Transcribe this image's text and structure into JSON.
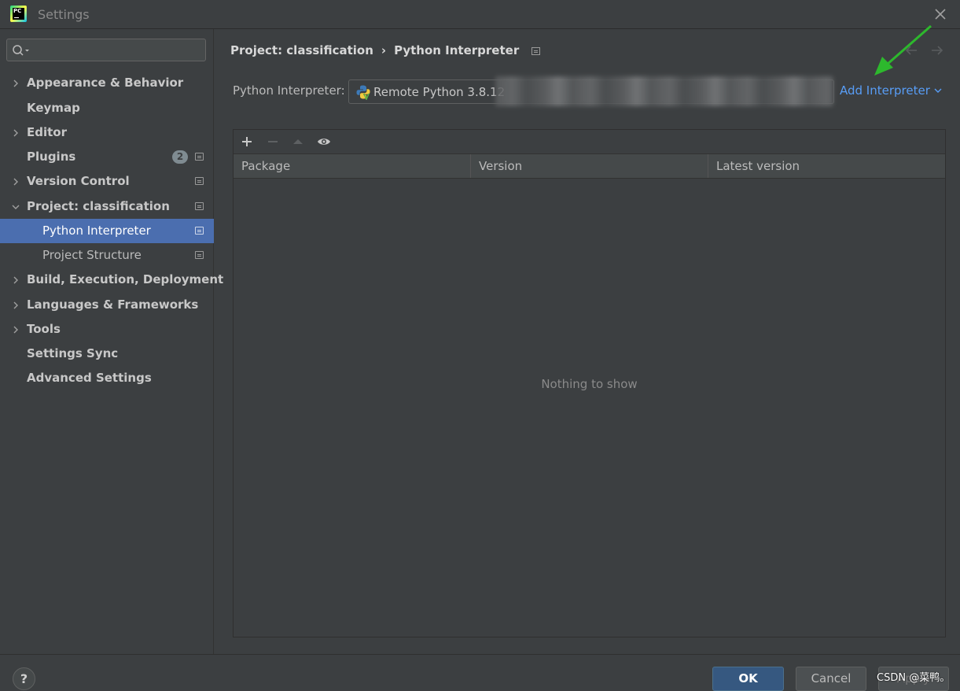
{
  "window": {
    "title": "Settings"
  },
  "sidebar": {
    "search_placeholder": "",
    "items": [
      {
        "label": "Appearance & Behavior"
      },
      {
        "label": "Keymap"
      },
      {
        "label": "Editor"
      },
      {
        "label": "Plugins",
        "badge": "2"
      },
      {
        "label": "Version Control"
      },
      {
        "label": "Project: classification"
      },
      {
        "label": "Python Interpreter"
      },
      {
        "label": "Project Structure"
      },
      {
        "label": "Build, Execution, Deployment"
      },
      {
        "label": "Languages & Frameworks"
      },
      {
        "label": "Tools"
      },
      {
        "label": "Settings Sync"
      },
      {
        "label": "Advanced Settings"
      }
    ],
    "selected": "Python Interpreter"
  },
  "breadcrumb": {
    "parent": "Project: classification",
    "current": "Python Interpreter"
  },
  "interpreter": {
    "label": "Python Interpreter:",
    "value": "Remote Python 3.8.12",
    "add_label": "Add Interpreter"
  },
  "packages": {
    "columns": [
      "Package",
      "Version",
      "Latest version"
    ],
    "rows": [],
    "empty_text": "Nothing to show"
  },
  "footer": {
    "ok_label": "OK",
    "cancel_label": "Cancel",
    "apply_label": "Apply",
    "help_label": "?"
  },
  "watermark": "CSDN @菜鸭。",
  "colors": {
    "background": "#3c3f41",
    "selection": "#4b6eaf",
    "link": "#589df6",
    "ok_button": "#365880",
    "annotation_arrow": "#2db82d"
  }
}
